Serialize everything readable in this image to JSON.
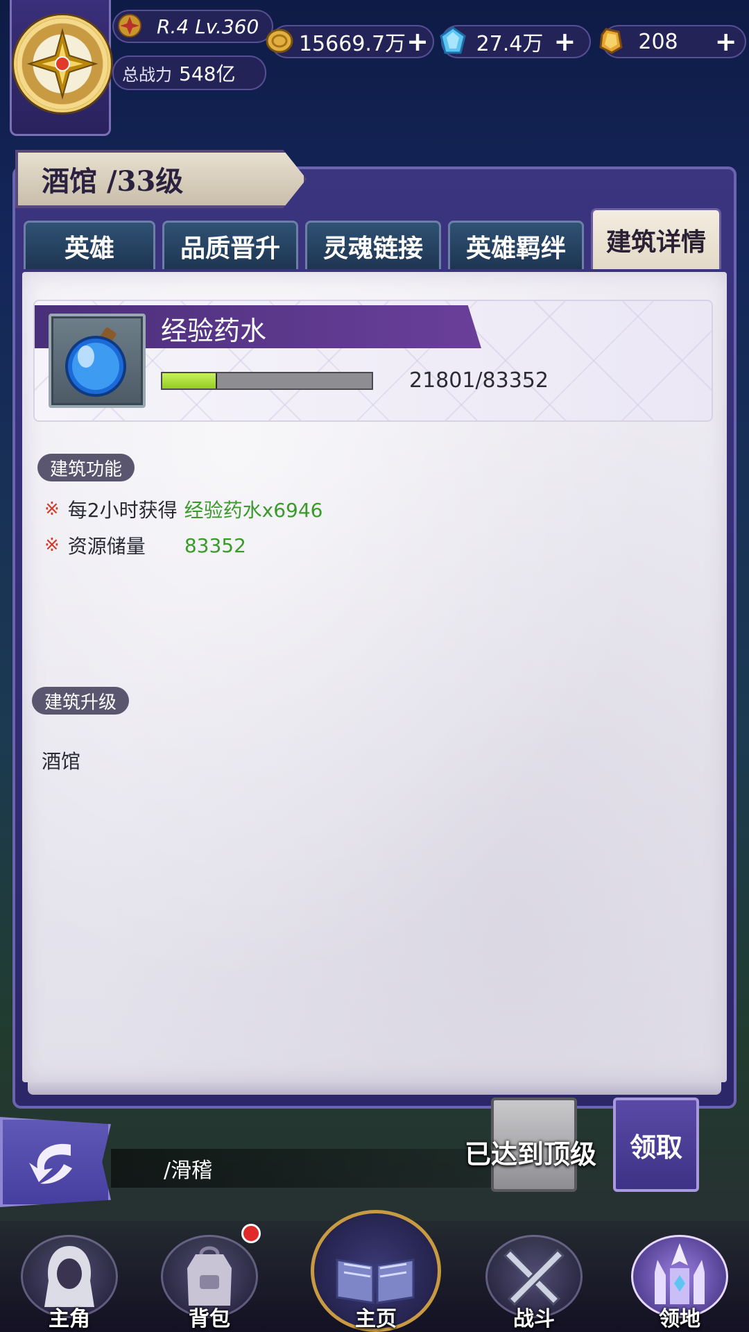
{
  "header": {
    "rank_level": "R.4 Lv.360",
    "power_label": "总战力",
    "power_value": "548亿",
    "resources": [
      {
        "icon": "gold-coin-icon",
        "value": "15669.7万"
      },
      {
        "icon": "blue-crystal-icon",
        "value": "27.4万"
      },
      {
        "icon": "gold-gem-icon",
        "value": "208"
      }
    ],
    "add_symbol": "+"
  },
  "panel": {
    "title": "酒馆",
    "level": "/33级",
    "tabs": [
      {
        "label": "英雄",
        "active": false
      },
      {
        "label": "品质晋升",
        "active": false
      },
      {
        "label": "灵魂链接",
        "active": false
      },
      {
        "label": "英雄羁绊",
        "active": false
      },
      {
        "label": "建筑详情",
        "active": true
      }
    ],
    "resource_card": {
      "name": "经验药水",
      "progress_text": "21801/83352",
      "current": 21801,
      "max": 83352
    },
    "function_section": {
      "label": "建筑功能",
      "mark": "※",
      "line1_prefix": "每2小时获得",
      "line1_value": "经验药水x6946",
      "line2_prefix": "资源储量",
      "line2_value": "83352"
    },
    "upgrade_section": {
      "label": "建筑升级",
      "text": "酒馆"
    }
  },
  "actions": {
    "info_text": "/滑稽",
    "max_level_text": "已达到顶级",
    "claim_label": "领取"
  },
  "nav": [
    {
      "label": "主角",
      "icon": "hero-icon"
    },
    {
      "label": "背包",
      "icon": "backpack-icon",
      "badge": true
    },
    {
      "label": "主页",
      "icon": "book-icon"
    },
    {
      "label": "战斗",
      "icon": "swords-icon"
    },
    {
      "label": "领地",
      "icon": "castle-icon"
    }
  ],
  "colors": {
    "accent_green": "#3a9a2a",
    "progress_fill": "#b4e23c",
    "mark_red": "#d23a2a"
  }
}
